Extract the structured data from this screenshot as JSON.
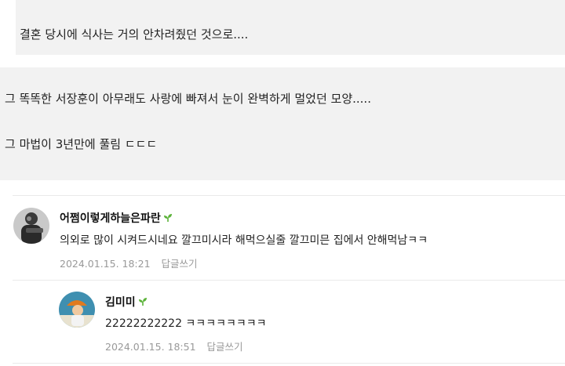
{
  "quotes": {
    "q1": "결혼 당시에 식사는 거의 안차려줬던 것으로....",
    "q2_line1": "그 똑똑한 서장훈이 아무래도 사랑에 빠져서 눈이 완벽하게 멀었던 모양.....",
    "q2_line2": "그 마법이 3년만에 풀림 ㄷㄷㄷ"
  },
  "comments": [
    {
      "nickname": "어쩜이렇게하늘은파란",
      "text": "의외로 많이 시켜드시네요 깔끄미시라 해먹으실줄 깔끄미믄 집에서 안해먹남ㅋㅋ",
      "date": "2024.01.15. 18:21",
      "reply_label": "답글쓰기"
    },
    {
      "nickname": "김미미",
      "text": "22222222222 ㅋㅋㅋㅋㅋㅋㅋㅋ",
      "date": "2024.01.15. 18:51",
      "reply_label": "답글쓰기"
    }
  ],
  "colors": {
    "leaf": "#5cb33a",
    "meta": "#999999",
    "quote_bg": "#f2f2f2"
  }
}
